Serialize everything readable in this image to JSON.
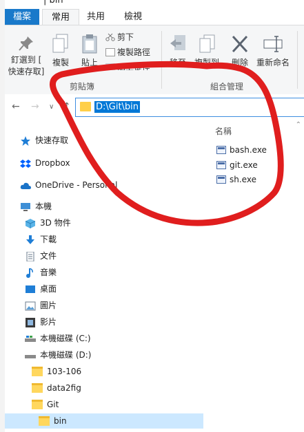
{
  "title_fragment": "| bin",
  "tabs": {
    "file": "檔案",
    "home": "常用",
    "share": "共用",
    "view": "檢視"
  },
  "ribbon": {
    "pin_label_1": "釘選到 [",
    "pin_label_2": "快速存取]",
    "copy_label": "複製",
    "paste_label": "貼上",
    "cut_label": "剪下",
    "copy_path_label": "複製路徑",
    "paste_shortcut_label": "貼上捷徑",
    "move_to_label": "移至",
    "copy_to_label": "複製到",
    "delete_label": "刪除",
    "rename_label": "重新命名",
    "clipboard_group": "剪貼簿",
    "organize_group": "組合管理"
  },
  "address": {
    "path": "D:\\Git\\bin"
  },
  "nav_pane": {
    "items": [
      {
        "label": "快速存取",
        "icon": "star-icon"
      },
      {
        "label": "Dropbox",
        "icon": "dropbox-icon"
      },
      {
        "label": "OneDrive - Personal",
        "icon": "cloud-icon"
      },
      {
        "label": "本機",
        "icon": "computer-icon"
      },
      {
        "label": "3D 物件",
        "icon": "cube-icon"
      },
      {
        "label": "下載",
        "icon": "download-icon"
      },
      {
        "label": "文件",
        "icon": "document-icon"
      },
      {
        "label": "音樂",
        "icon": "music-icon"
      },
      {
        "label": "桌面",
        "icon": "desktop-icon"
      },
      {
        "label": "圖片",
        "icon": "pictures-icon"
      },
      {
        "label": "影片",
        "icon": "video-icon"
      },
      {
        "label": "本機磁碟 (C:)",
        "icon": "drive-icon"
      },
      {
        "label": "本機磁碟 (D:)",
        "icon": "drive-icon"
      },
      {
        "label": "103-106",
        "icon": "folder-icon"
      },
      {
        "label": "data2fig",
        "icon": "folder-icon"
      },
      {
        "label": "Git",
        "icon": "folder-icon"
      },
      {
        "label": "bin",
        "icon": "folder-icon"
      }
    ]
  },
  "content": {
    "column_name": "名稱",
    "files": [
      {
        "name": "bash.exe"
      },
      {
        "name": "git.exe"
      },
      {
        "name": "sh.exe"
      }
    ]
  },
  "colors": {
    "accent": "#1979ca",
    "selection": "#0078d7",
    "annotation": "#e01e1e"
  }
}
